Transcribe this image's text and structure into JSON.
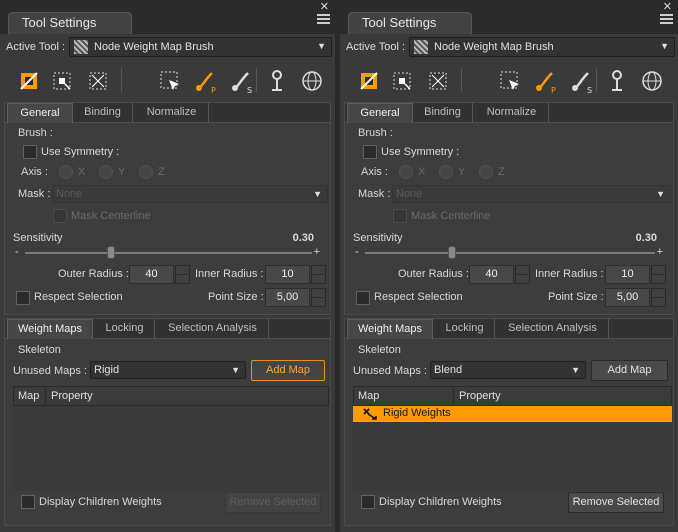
{
  "panels": [
    {
      "title": "Tool Settings",
      "close_glyph": "✕",
      "active_tool_label": "Active Tool :",
      "active_tool_value": "Node Weight Map Brush",
      "general_tabs": [
        "General",
        "Binding",
        "Normalize"
      ],
      "brush_label": "Brush :",
      "use_symmetry_label": "Use Symmetry :",
      "axis_label": "Axis :",
      "axis_options": [
        "X",
        "Y",
        "Z"
      ],
      "mask_label": "Mask :",
      "mask_value": "None",
      "mask_centerline_label": "Mask Centerline",
      "sensitivity_label": "Sensitivity",
      "sensitivity_value": "0.30",
      "sensitivity_fraction": 0.3,
      "slider_minus": "-",
      "slider_plus": "+",
      "outer_radius_label": "Outer Radius :",
      "outer_radius_value": "40",
      "inner_radius_label": "Inner Radius :",
      "inner_radius_value": "10",
      "respect_selection_label": "Respect Selection",
      "point_size_label": "Point Size :",
      "point_size_value": "5,00",
      "weight_tabs": [
        "Weight Maps",
        "Locking",
        "Selection Analysis"
      ],
      "skeleton_label": "Skeleton",
      "unused_maps_label": "Unused Maps :",
      "unused_maps_value": "Rigid",
      "add_map_label": "Add Map",
      "columns": [
        "Map",
        "Property"
      ],
      "rows": [],
      "display_children_label": "Display Children Weights",
      "remove_selected_label": "Remove Selected",
      "remove_enabled": false,
      "add_map_highlighted": true
    },
    {
      "title": "Tool Settings",
      "close_glyph": "✕",
      "active_tool_label": "Active Tool :",
      "active_tool_value": "Node Weight Map Brush",
      "general_tabs": [
        "General",
        "Binding",
        "Normalize"
      ],
      "brush_label": "Brush :",
      "use_symmetry_label": "Use Symmetry :",
      "axis_label": "Axis :",
      "axis_options": [
        "X",
        "Y",
        "Z"
      ],
      "mask_label": "Mask :",
      "mask_value": "None",
      "mask_centerline_label": "Mask Centerline",
      "sensitivity_label": "Sensitivity",
      "sensitivity_value": "0.30",
      "sensitivity_fraction": 0.3,
      "slider_minus": "-",
      "slider_plus": "+",
      "outer_radius_label": "Outer Radius :",
      "outer_radius_value": "40",
      "inner_radius_label": "Inner Radius :",
      "inner_radius_value": "10",
      "respect_selection_label": "Respect Selection",
      "point_size_label": "Point Size :",
      "point_size_value": "5,00",
      "weight_tabs": [
        "Weight Maps",
        "Locking",
        "Selection Analysis"
      ],
      "skeleton_label": "Skeleton",
      "unused_maps_label": "Unused Maps :",
      "unused_maps_value": "Blend",
      "add_map_label": "Add Map",
      "columns": [
        "Map",
        "Property"
      ],
      "rows": [
        {
          "label": "Rigid Weights",
          "selected": true
        }
      ],
      "display_children_label": "Display Children Weights",
      "remove_selected_label": "Remove Selected",
      "remove_enabled": true,
      "add_map_highlighted": false
    }
  ],
  "toolbar_icons": [
    "node-weight-brush-icon",
    "node-select-icon",
    "scale-select-icon",
    "region-select-icon",
    "paint-brush-icon",
    "smooth-brush-icon",
    "pin-icon",
    "sphere-icon"
  ],
  "colors": {
    "accent": "#ff9a00",
    "panel": "#3a3a3a",
    "dark": "#2b2b2b"
  }
}
